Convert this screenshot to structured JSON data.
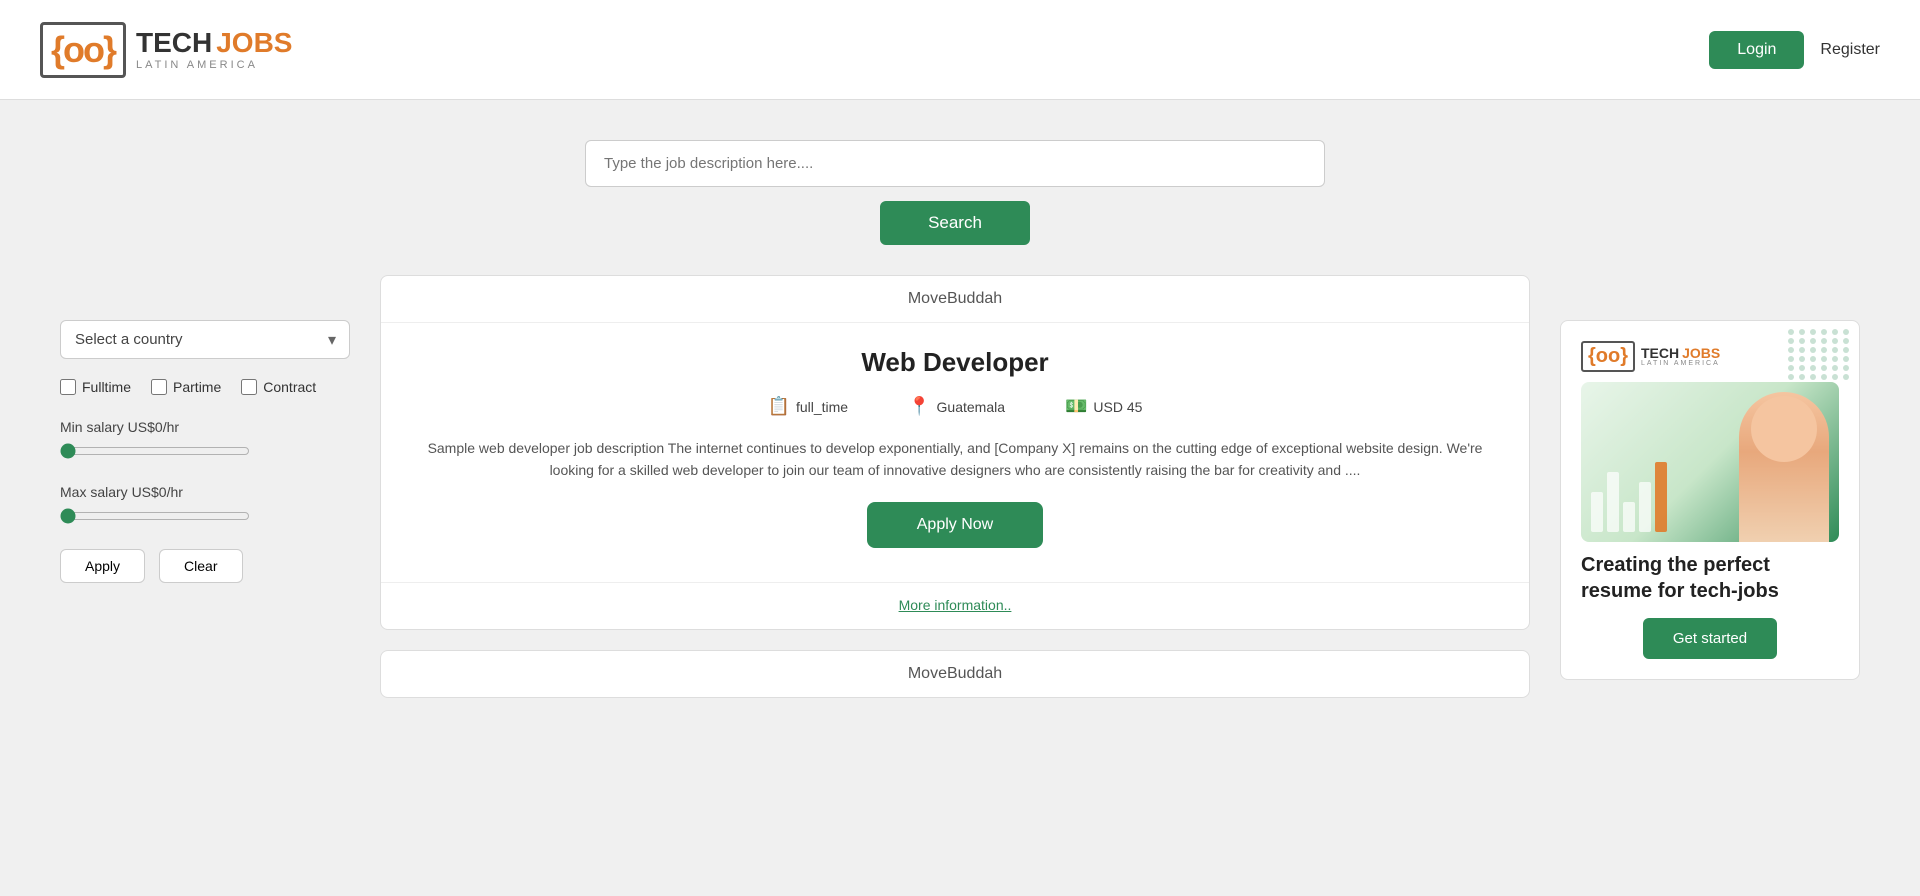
{
  "header": {
    "logo_icon": "{oo}",
    "logo_tech": "TECH",
    "logo_jobs": "JOBS",
    "logo_latin": "LATIN AMERICA",
    "login_label": "Login",
    "register_label": "Register"
  },
  "search": {
    "placeholder": "Type the job description here....",
    "button_label": "Search"
  },
  "sidebar": {
    "country_placeholder": "Select a country",
    "filter_fulltime": "Fulltime",
    "filter_partime": "Partime",
    "filter_contract": "Contract",
    "min_salary_label": "Min salary US$0/hr",
    "max_salary_label": "Max salary US$0/hr",
    "apply_label": "Apply",
    "clear_label": "Clear"
  },
  "jobs": [
    {
      "company": "MoveBuddah",
      "title": "Web Developer",
      "type": "full_time",
      "location": "Guatemala",
      "salary": "USD 45",
      "description": "Sample web developer job description The internet continues to develop exponentially, and [Company X] remains on the cutting edge of exceptional website design. We're looking for a skilled web developer to join our team of innovative designers who are consistently raising the bar for creativity and ....",
      "apply_label": "Apply Now",
      "more_info_label": "More information.."
    }
  ],
  "second_company": "MoveBuddah",
  "ad": {
    "logo_tech": "TECH",
    "logo_jobs": "JOBS",
    "logo_latin": "LATIN AMERICA",
    "headline": "Creating the perfect resume for tech-jobs",
    "get_started_label": "Get started"
  }
}
